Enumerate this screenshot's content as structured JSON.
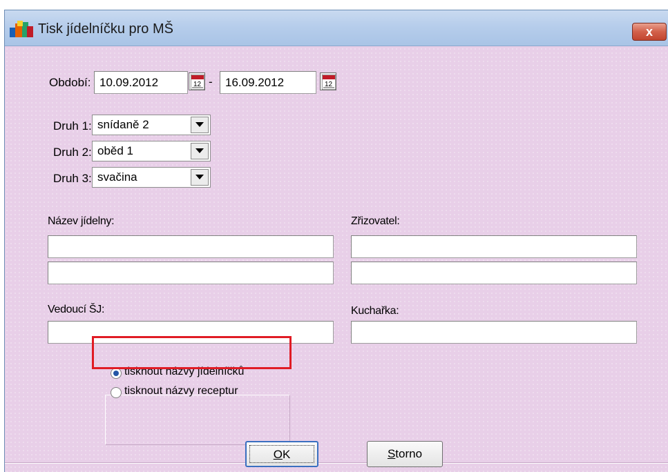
{
  "window": {
    "title": "Tisk jídelníčku pro MŠ",
    "close_label": "x"
  },
  "period": {
    "label": "Období:",
    "from": "10.09.2012",
    "separator": "-",
    "to": "16.09.2012"
  },
  "kinds": [
    {
      "label": "Druh 1:",
      "value": "snídaně 2"
    },
    {
      "label": "Druh 2:",
      "value": "oběd 1"
    },
    {
      "label": "Druh 3:",
      "value": "svačina"
    }
  ],
  "fields": {
    "canteen_name_label": "Název jídelny:",
    "founder_label": "Zřizovatel:",
    "head_label": "Vedoucí ŠJ:",
    "cook_label": "Kuchařka:",
    "canteen_name_1": "",
    "canteen_name_2": "",
    "founder_1": "",
    "founder_2": "",
    "head": "",
    "cook": ""
  },
  "print_options": {
    "option1": "tisknout názvy jídelníčků",
    "option2": "tisknout názvy receptur",
    "selected": "option1"
  },
  "buttons": {
    "ok_accel": "O",
    "ok_rest": "K",
    "cancel_accel": "S",
    "cancel_rest": "torno"
  },
  "colors": {
    "background": "#e8cfe8",
    "highlight": "#e01b24",
    "title_bar": "#b6cdeb",
    "close_button": "#c2452f"
  }
}
